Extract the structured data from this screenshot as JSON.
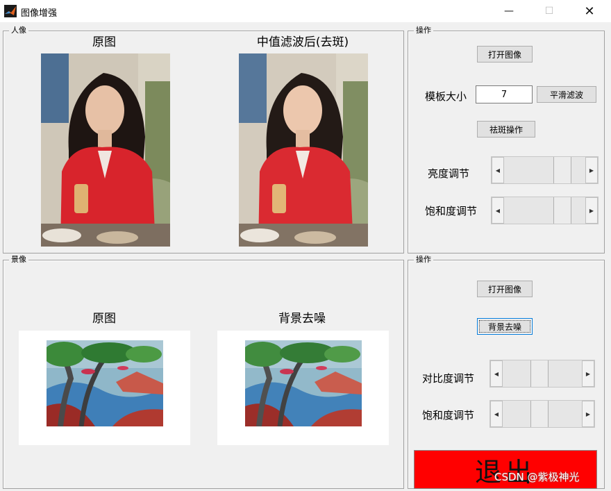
{
  "window": {
    "title": "图像增强",
    "app_icon": "matlab-icon",
    "minimize_icon": "minimize-icon",
    "maximize_icon": "maximize-icon",
    "close_icon": "close-icon"
  },
  "portrait_panel": {
    "legend": "人像",
    "original_caption": "原图",
    "processed_caption": "中值滤波后(去斑)"
  },
  "portrait_ops": {
    "legend": "操作",
    "open_image_label": "打开图像",
    "template_size_label": "模板大小",
    "template_size_value": "7",
    "smooth_filter_label": "平滑滤波",
    "remove_spots_label": "祛斑操作",
    "brightness_label": "亮度调节",
    "saturation_label": "饱和度调节",
    "brightness_level": 0.78,
    "saturation_level": 0.78
  },
  "scenery_panel": {
    "legend": "景像",
    "original_caption": "原图",
    "denoised_caption": "背景去噪"
  },
  "scenery_ops": {
    "legend": "操作",
    "open_image_label": "打开图像",
    "denoise_label": "背景去噪",
    "contrast_label": "对比度调节",
    "saturation_label": "饱和度调节",
    "contrast_level": 0.45,
    "saturation_level": 0.45
  },
  "exit_label": "退出",
  "watermark": "CSDN @紫极神光",
  "colors": {
    "exit_background": "#ff0000",
    "jacket_red": "#d8242c",
    "window_bg": "#f0f0f0"
  }
}
